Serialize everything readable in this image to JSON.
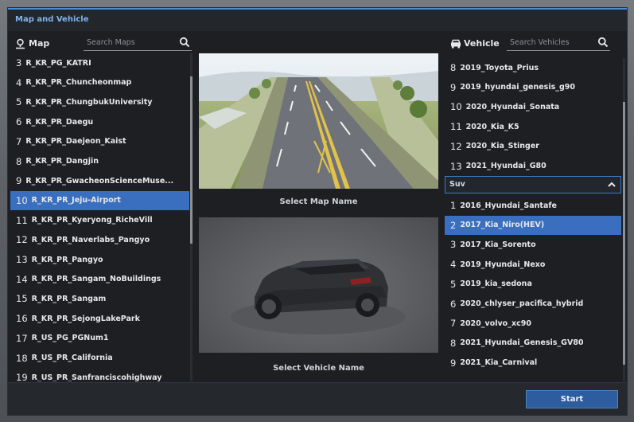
{
  "window": {
    "title": "Map and Vehicle"
  },
  "map_panel": {
    "label": "Map",
    "search_placeholder": "Search Maps",
    "items": [
      {
        "num": "3",
        "name": "R_KR_PG_KATRI"
      },
      {
        "num": "4",
        "name": "R_KR_PR_Chuncheonmap"
      },
      {
        "num": "5",
        "name": "R_KR_PR_ChungbukUniversity"
      },
      {
        "num": "6",
        "name": "R_KR_PR_Daegu"
      },
      {
        "num": "7",
        "name": "R_KR_PR_Daejeon_Kaist"
      },
      {
        "num": "8",
        "name": "R_KR_PR_Dangjin"
      },
      {
        "num": "9",
        "name": "R_KR_PR_GwacheonScienceMuse..."
      },
      {
        "num": "10",
        "name": "R_KR_PR_Jeju-Airport"
      },
      {
        "num": "11",
        "name": "R_KR_PR_Kyeryong_RicheVill"
      },
      {
        "num": "12",
        "name": "R_KR_PR_Naverlabs_Pangyo"
      },
      {
        "num": "13",
        "name": "R_KR_PR_Pangyo"
      },
      {
        "num": "14",
        "name": "R_KR_PR_Sangam_NoBuildings"
      },
      {
        "num": "15",
        "name": "R_KR_PR_Sangam"
      },
      {
        "num": "16",
        "name": "R_KR_PR_SejongLakePark"
      },
      {
        "num": "17",
        "name": "R_US_PG_PGNum1"
      },
      {
        "num": "18",
        "name": "R_US_PR_California"
      },
      {
        "num": "19",
        "name": "R_US_PR_Sanfranciscohighway"
      }
    ],
    "selected": "10"
  },
  "preview": {
    "map_caption": "Select Map  Name",
    "vehicle_caption": "Select Vehicle Name"
  },
  "vehicle_panel": {
    "label": "Vehicle",
    "search_placeholder": "Search Vehicles",
    "top_items": [
      {
        "num": "8",
        "name": "2019_Toyota_Prius"
      },
      {
        "num": "9",
        "name": "2019_hyundai_genesis_g90"
      },
      {
        "num": "10",
        "name": "2020_Hyundai_Sonata"
      },
      {
        "num": "11",
        "name": "2020_Kia_K5"
      },
      {
        "num": "12",
        "name": "2020_Kia_Stinger"
      },
      {
        "num": "13",
        "name": "2021_Hyundai_G80"
      }
    ],
    "category": "Suv",
    "suv_items": [
      {
        "num": "1",
        "name": "2016_Hyundai_Santafe"
      },
      {
        "num": "2",
        "name": "2017_Kia_Niro(HEV)"
      },
      {
        "num": "3",
        "name": "2017_Kia_Sorento"
      },
      {
        "num": "4",
        "name": "2019_Hyundai_Nexo"
      },
      {
        "num": "5",
        "name": "2019_kia_sedona"
      },
      {
        "num": "6",
        "name": "2020_chlyser_pacifica_hybrid"
      },
      {
        "num": "7",
        "name": "2020_volvo_xc90"
      },
      {
        "num": "8",
        "name": "2021_Hyundai_Genesis_GV80"
      },
      {
        "num": "9",
        "name": "2021_Kia_Carnival"
      }
    ],
    "selected": "2017_Kia_Niro(HEV)"
  },
  "footer": {
    "start_label": "Start"
  },
  "colors": {
    "accent": "#3a6fbf",
    "title": "#7fb4ec",
    "background": "#1d1f23"
  },
  "icons": {
    "map": "map-pin-icon",
    "vehicle": "car-icon",
    "search": "search-icon",
    "collapse": "chevron-up-icon"
  }
}
